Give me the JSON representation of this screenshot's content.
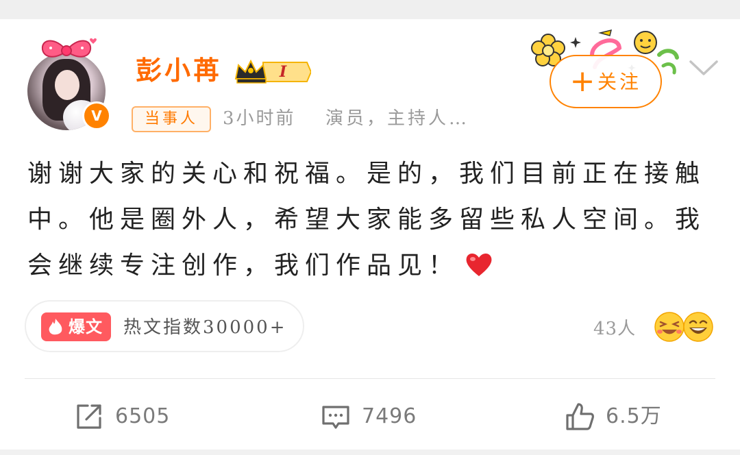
{
  "user": {
    "name": "彭小苒",
    "vip_level": "I",
    "role_badge": "当事人",
    "time": "3小时前",
    "description": "演员，主持人…",
    "verified_mark": "V"
  },
  "header": {
    "follow_plus": "+",
    "follow_label": "关注"
  },
  "post": {
    "text": "谢谢大家的关心和祝福。是的，我们目前正在接触中。他是圈外人，希望大家能多留些私人空间。我会继续专注创作，我们作品见！"
  },
  "hot": {
    "tag": "爆文",
    "text": "热文指数30000+"
  },
  "reactions": {
    "count": "43人"
  },
  "actions": {
    "repost_count": "6505",
    "comment_count": "7496",
    "like_count": "6.5万"
  },
  "colors": {
    "brand_orange": "#ff8200",
    "name_orange": "#ff6a00",
    "hot_red": "#ff5a5f",
    "heart_red": "#e8262f"
  },
  "icons": [
    "verified-icon",
    "vip-crown-icon",
    "chevron-down-icon",
    "flame-icon",
    "heart-icon",
    "repost-icon",
    "comment-icon",
    "like-icon"
  ]
}
